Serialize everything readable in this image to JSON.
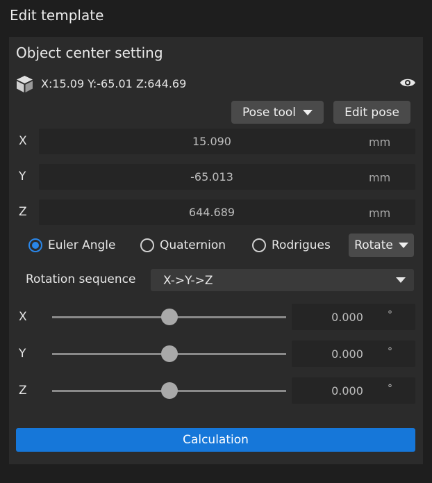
{
  "header": {
    "title": "Edit template"
  },
  "section": {
    "title": "Object center setting",
    "summary": "X:15.09 Y:-65.01 Z:644.69"
  },
  "toolbar": {
    "pose_tool_label": "Pose tool",
    "edit_pose_label": "Edit pose"
  },
  "position": [
    {
      "label": "X",
      "value": "15.090",
      "unit": "mm"
    },
    {
      "label": "Y",
      "value": "-65.013",
      "unit": "mm"
    },
    {
      "label": "Z",
      "value": "644.689",
      "unit": "mm"
    }
  ],
  "rotation_modes": {
    "options": [
      "Euler Angle",
      "Quaternion",
      "Rodrigues"
    ],
    "selected": "Euler Angle",
    "rotate_label": "Rotate"
  },
  "rotation_sequence": {
    "label": "Rotation sequence",
    "value": "X->Y->Z"
  },
  "angles": [
    {
      "label": "X",
      "value": "0.000",
      "unit": "°",
      "slider_fraction": 0.5
    },
    {
      "label": "Y",
      "value": "0.000",
      "unit": "°",
      "slider_fraction": 0.5
    },
    {
      "label": "Z",
      "value": "0.000",
      "unit": "°",
      "slider_fraction": 0.5
    }
  ],
  "actions": {
    "calculation_label": "Calculation"
  },
  "colors": {
    "accent": "#1677d9",
    "panel": "#2b2b2b",
    "background": "#1e1e1e"
  }
}
